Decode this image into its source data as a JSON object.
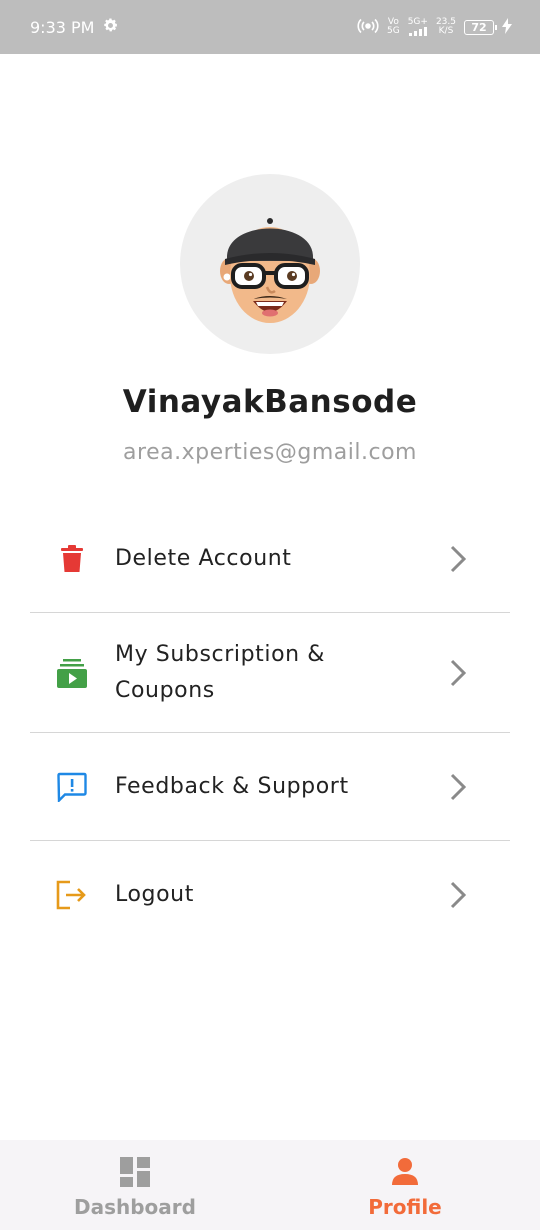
{
  "status_bar": {
    "time": "9:33 PM",
    "vo": "Vo",
    "five_g_small": "5G",
    "five_g_plus": "5G+",
    "speed_value": "23.5",
    "speed_unit": "K/S",
    "battery": "72"
  },
  "profile": {
    "name": "VinayakBansode",
    "email": "area.xperties@gmail.com"
  },
  "menu": {
    "items": [
      {
        "label": "Delete Account",
        "icon": "trash-icon",
        "color": "#e53935"
      },
      {
        "label": "My Subscription & Coupons",
        "icon": "subscriptions-icon",
        "color": "#43a047"
      },
      {
        "label": "Feedback & Support",
        "icon": "feedback-icon",
        "color": "#1e88e5"
      },
      {
        "label": "Logout",
        "icon": "logout-icon",
        "color": "#e69a1a"
      }
    ]
  },
  "bottom_nav": {
    "dashboard": "Dashboard",
    "profile": "Profile",
    "active_tab": "Profile",
    "active_color": "#f26b3a",
    "inactive_color": "#9e9e9e"
  }
}
